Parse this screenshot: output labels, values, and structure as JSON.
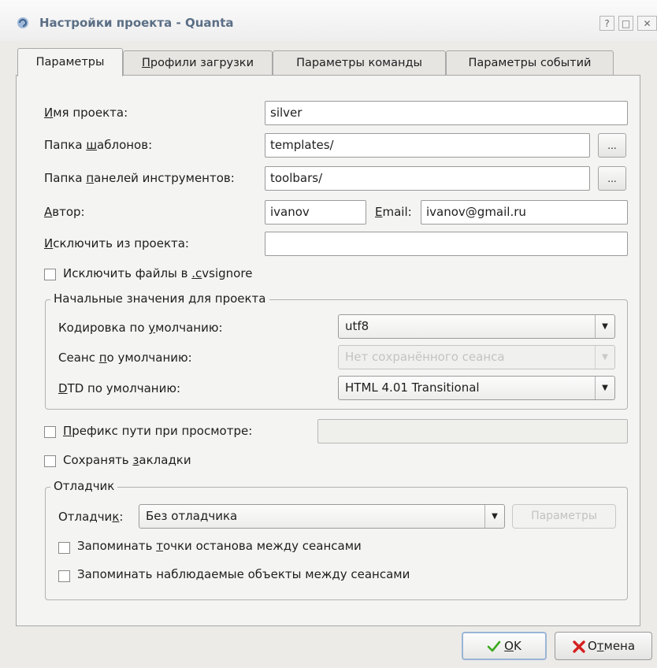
{
  "window": {
    "title": "Настройки проекта - Quanta",
    "buttons": [
      "?",
      "□",
      "✕"
    ]
  },
  "tabs": [
    {
      "label": "Параметры",
      "underline": "",
      "rest": "Параметры",
      "active": true
    },
    {
      "label": "Профили загрузки",
      "underline": "П",
      "rest": "рофили загрузки",
      "active": false
    },
    {
      "label": "Параметры команды",
      "underline": "",
      "rest": "Параметры команды",
      "active": false
    },
    {
      "label": "Параметры событий",
      "underline": "",
      "rest": "Параметры событий",
      "active": false
    }
  ],
  "fields": {
    "project_name": {
      "label_ul": "И",
      "label_rest": "мя проекта:",
      "value": "silver"
    },
    "templates": {
      "label_pre": "Папка ",
      "label_ul": "ш",
      "label_rest": "аблонов:",
      "value": "templates/",
      "browse": "..."
    },
    "toolbars": {
      "label_pre": "Папка ",
      "label_ul": "п",
      "label_rest": "анелей инструментов:",
      "value": "toolbars/",
      "browse": "..."
    },
    "author": {
      "label_ul": "А",
      "label_rest": "втор:",
      "value": "ivanov"
    },
    "email": {
      "label_ul": "E",
      "label_rest": "mail:",
      "value": "ivanov@gmail.ru"
    },
    "exclude": {
      "label_ul": "И",
      "label_rest": "сключить из проекта:",
      "value": ""
    }
  },
  "exclude_cvsignore": {
    "pre": "Исключить файлы в ",
    "ul": ".c",
    "rest": "vsignore",
    "checked": false
  },
  "defaults_group": {
    "title": "Начальные значения для проекта",
    "encoding": {
      "pre": "Кодировка по ",
      "ul": "у",
      "rest": "молчанию:",
      "value": "utf8"
    },
    "session": {
      "pre": "Сеанс ",
      "ul": "п",
      "rest": "о умолчанию:",
      "value": "Нет сохранённого сеанса",
      "disabled": true
    },
    "dtd": {
      "pre": "",
      "ul": "D",
      "rest": "TD по умолчанию:",
      "value": "HTML 4.01 Transitional"
    }
  },
  "preview_prefix": {
    "ul": "П",
    "rest": "рефикс пути при просмотре:",
    "checked": false,
    "value": ""
  },
  "save_bookmarks": {
    "pre": "Сохранять ",
    "ul": "з",
    "rest": "акладки",
    "checked": false
  },
  "debugger_group": {
    "title": "Отладчик",
    "label_pre": "Отладчи",
    "label_ul": "к",
    "label_rest": ":",
    "value": "Без отладчика",
    "settings_button": "Параметры",
    "remember_breakpoints": {
      "pre": "Запоминать ",
      "ul": "т",
      "rest": "очки останова между сеансами",
      "checked": false
    },
    "remember_watches": {
      "text": "Запоминать наблюдаемые объекты между сеансами",
      "checked": false
    }
  },
  "footer": {
    "ok": {
      "ul": "O",
      "rest": "K"
    },
    "cancel": {
      "pre": "О",
      "ul": "т",
      "rest": "мена"
    }
  },
  "colors": {
    "ok_check": "#3caa1e",
    "cancel_x": "#d42020",
    "title_text": "#5b6f86"
  }
}
